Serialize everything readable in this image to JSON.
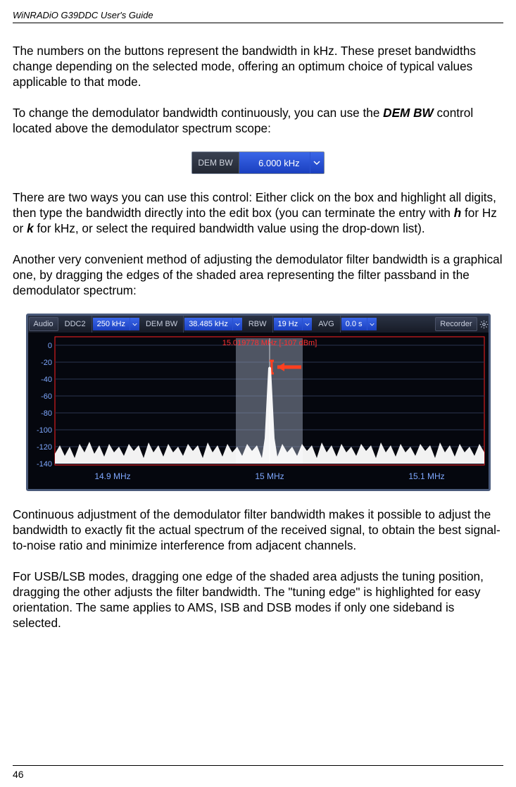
{
  "header": {
    "title": "WiNRADiO G39DDC User's Guide"
  },
  "paragraphs": {
    "p1": "The numbers on the buttons represent the bandwidth in kHz. These preset bandwidths change depending on the selected mode, offering an optimum choice of typical values applicable to that mode.",
    "p2a": "To change the demodulator bandwidth continuously, you can use the ",
    "p2b": "DEM BW",
    "p2c": " control located above the demodulator spectrum scope:",
    "p3a": "There are two ways you can use this control: Either click on the box and highlight all digits, then type the bandwidth directly into the edit box (you can terminate the entry with ",
    "p3b": "h",
    "p3c": " for Hz or ",
    "p3d": "k",
    "p3e": " for kHz, or select the required bandwidth value using the drop-down list).",
    "p4": "Another very convenient method of adjusting the demodulator filter bandwidth is a graphical one, by dragging the edges of the shaded area representing the filter passband in the demodulator spectrum:",
    "p5": "Continuous adjustment of the demodulator filter bandwidth makes it possible to adjust the bandwidth to exactly fit the actual spectrum of the received signal, to obtain the best signal-to-noise ratio and minimize interference from adjacent channels.",
    "p6": "For USB/LSB modes, dragging one edge of the shaded area adjusts the tuning position, dragging the other adjusts the filter bandwidth. The \"tuning edge\" is highlighted for easy orientation. The same applies to AMS, ISB and DSB modes if only one sideband is selected."
  },
  "dembw_small": {
    "label": "DEM BW",
    "value": "6.000 kHz"
  },
  "spectrum": {
    "toolbar": {
      "audio": "Audio",
      "ddc2_label": "DDC2",
      "ddc2_value": "250 kHz",
      "dembw_label": "DEM BW",
      "dembw_value": "38.485 kHz",
      "rbw_label": "RBW",
      "rbw_value": "19 Hz",
      "avg_label": "AVG",
      "avg_value": "0.0 s",
      "recorder": "Recorder"
    },
    "marker": "15.019778 MHz [-107 dBm]",
    "yticks": [
      "0",
      "-20",
      "-40",
      "-60",
      "-80",
      "-100",
      "-120",
      "-140"
    ],
    "xticks": [
      "14.9 MHz",
      "15 MHz",
      "15.1 MHz"
    ]
  },
  "footer": {
    "page": "46"
  }
}
